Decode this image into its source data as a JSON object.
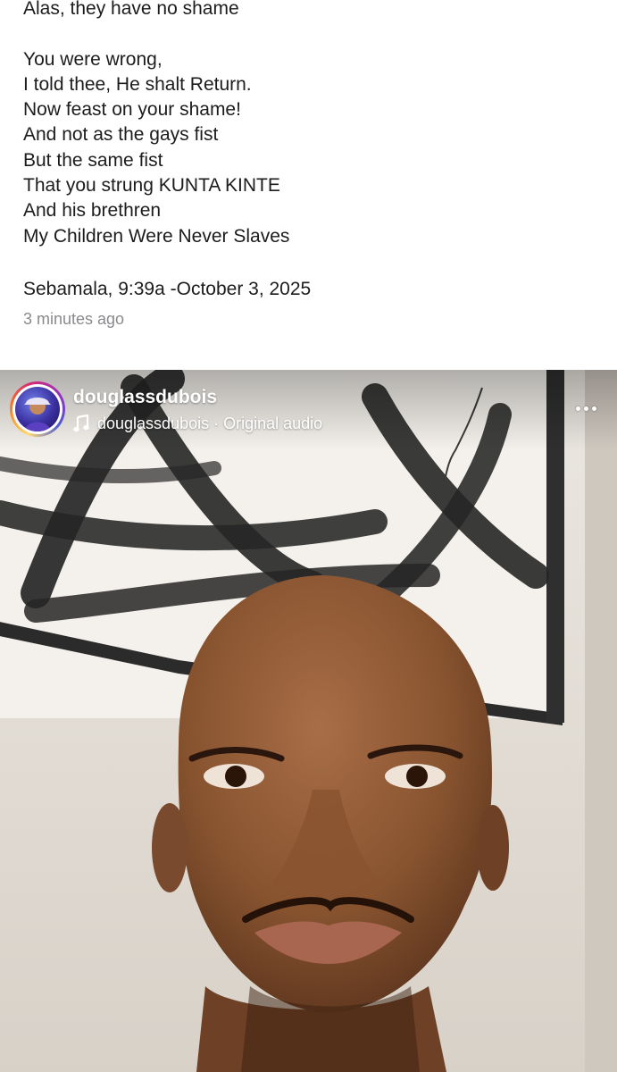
{
  "caption": {
    "lines": [
      "Alas, they have no shame",
      "",
      "You were wrong,",
      "I told thee, He shalt Return.",
      "Now feast on your shame!",
      "And not as the gays fist",
      "But the same fist",
      "That you strung KUNTA KINTE",
      "And his brethren",
      "My Children Were Never Slaves"
    ],
    "signature": "Sebamala, 9:39a -October 3, 2025",
    "time_ago": "3 minutes ago"
  },
  "reel": {
    "username": "douglassdubois",
    "audio_owner": "douglassdubois",
    "audio_separator": " · ",
    "audio_title": "Original audio",
    "icons": {
      "avatar_ring": "story-ring",
      "audio": "music-note-icon",
      "menu": "more-horizontal-icon"
    },
    "colors": {
      "ring_start": "#feda75",
      "ring_end": "#962fbf",
      "header_text": "#ffffff"
    }
  }
}
